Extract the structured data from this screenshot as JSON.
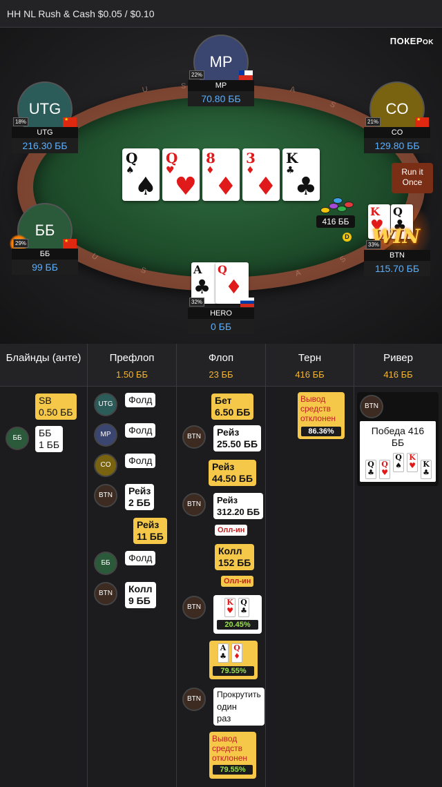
{
  "title": "HH NL Rush & Cash $0.05 / $0.10",
  "brand": "ПОКЕР",
  "brand_mark": "OK",
  "seats": {
    "mp": {
      "avatar": "MP",
      "name": "MP",
      "stack": "70.80 ББ",
      "pct": "22%",
      "flag": "chile-flag"
    },
    "utg": {
      "avatar": "UTG",
      "name": "UTG",
      "stack": "216.30 ББ",
      "pct": "18%",
      "flag": "china-flag"
    },
    "co": {
      "avatar": "CO",
      "name": "CO",
      "stack": "129.80 ББ",
      "pct": "21%",
      "flag": "china-flag"
    },
    "bb": {
      "avatar": "ББ",
      "name": "ББ",
      "stack": "99 ББ",
      "pct": "29%",
      "flag": "china-flag"
    },
    "btn": {
      "name": "BTN",
      "stack": "115.70 ББ",
      "pct": "33%"
    },
    "hero": {
      "name": "HERO",
      "stack": "0 ББ",
      "pct": "32%",
      "flag": "russia-flag"
    }
  },
  "board": [
    {
      "rank": "Q",
      "suit": "♠",
      "color": "black"
    },
    {
      "rank": "Q",
      "suit": "♥",
      "color": "red"
    },
    {
      "rank": "8",
      "suit": "♦",
      "color": "red"
    },
    {
      "rank": "3",
      "suit": "♦",
      "color": "red"
    },
    {
      "rank": "K",
      "suit": "♣",
      "color": "black"
    }
  ],
  "hero_cards": [
    {
      "rank": "A",
      "suit": "♣"
    },
    {
      "rank": "Q",
      "suit": "♦"
    }
  ],
  "btn_cards": [
    {
      "rank": "K",
      "suit": "♥"
    },
    {
      "rank": "Q",
      "suit": "♣"
    }
  ],
  "pot": "416 ББ",
  "dealer_label": "D",
  "run_it_once": "Run it Once",
  "win_label": "WIN",
  "rail_text": [
    "U",
    "S",
    "A",
    "S",
    "U",
    "S",
    "A",
    "S"
  ],
  "history": {
    "columns": [
      {
        "title": "Блайнды (анте)",
        "pot": ""
      },
      {
        "title": "Префлоп",
        "pot": "1.50 ББ"
      },
      {
        "title": "Флоп",
        "pot": "23 ББ"
      },
      {
        "title": "Терн",
        "pot": "416 ББ"
      },
      {
        "title": "Ривер",
        "pot": "416 ББ"
      }
    ],
    "blinds": {
      "sb_line1": "SB",
      "sb_line2": "0.50 ББ",
      "bb_avatar": "ББ",
      "bb_line1": "ББ",
      "bb_line2": "1 ББ"
    },
    "preflop": {
      "utg_avatar": "UTG",
      "utg_action": "Фолд",
      "mp_avatar": "MP",
      "mp_action": "Фолд",
      "co_avatar": "CO",
      "co_action": "Фолд",
      "btn_avatar": "BTN",
      "btn_raise_1": "Рейз",
      "btn_raise_2": "2 ББ",
      "hero_raise_1": "Рейз",
      "hero_raise_2": "11 ББ",
      "bb_avatar": "ББ",
      "bb_action": "Фолд",
      "btn_call_avatar": "BTN",
      "btn_call_1": "Колл",
      "btn_call_2": "9 ББ"
    },
    "flop": {
      "hero_bet_1": "Бет",
      "hero_bet_2": "6.50 ББ",
      "btn_raise_avatar": "BTN",
      "btn_raise_1": "Рейз",
      "btn_raise_2": "25.50 ББ",
      "hero_raise_1": "Рейз",
      "hero_raise_2": "44.50 ББ",
      "btn_allin_avatar": "BTN",
      "btn_allin_1": "Рейз",
      "btn_allin_2": "312.20 ББ",
      "btn_allin_tag": "Олл-ин",
      "hero_call_1": "Колл",
      "hero_call_2": "152 ББ",
      "hero_call_tag": "Олл-ин",
      "btn_show_avatar": "BTN",
      "btn_equity": "20.45%",
      "hero_equity": "79.55%",
      "btn_runit_avatar": "BTN",
      "btn_runit_1": "Прокрутить",
      "btn_runit_2": "один",
      "btn_runit_3": "раз",
      "hero_cashout_1": "Вывод",
      "hero_cashout_2": "средств",
      "hero_cashout_3": "отклонен",
      "hero_cashout_eq": "79.55%"
    },
    "turn": {
      "cashout_1": "Вывод",
      "cashout_2": "средств",
      "cashout_3": "отклонен",
      "cashout_eq": "86.36%"
    },
    "river": {
      "btn_avatar": "BTN",
      "win_text": "Победа 416 ББ",
      "mini_cards": [
        {
          "rank": "Q",
          "suit": "♣",
          "color": "black"
        },
        {
          "rank": "Q",
          "suit": "♥",
          "color": "red"
        },
        {
          "rank": "Q",
          "suit": "♠",
          "color": "black"
        },
        {
          "rank": "K",
          "suit": "♥",
          "color": "red"
        },
        {
          "rank": "K",
          "suit": "♣",
          "color": "black"
        }
      ]
    }
  }
}
